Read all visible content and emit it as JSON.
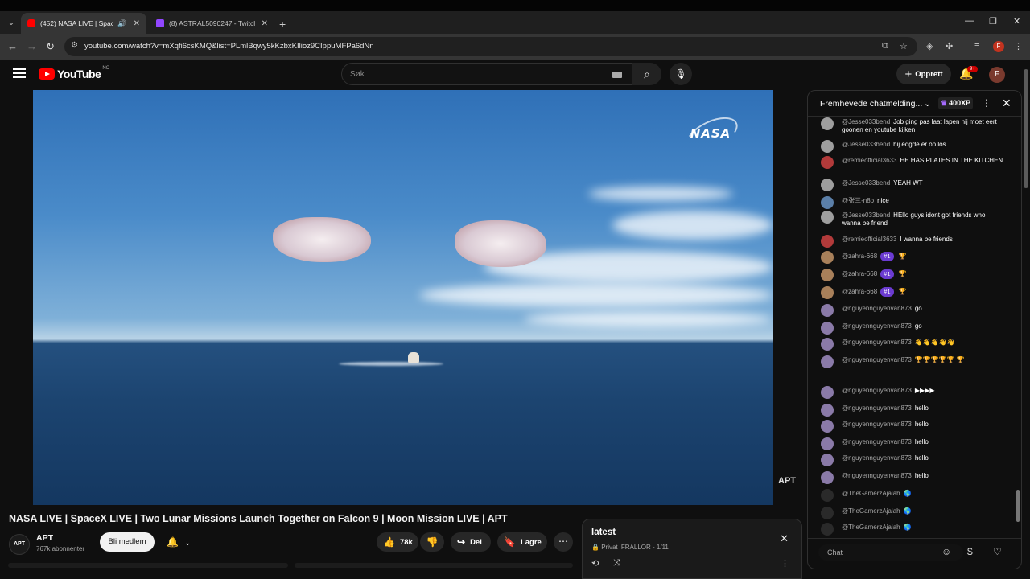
{
  "browser": {
    "tabs": [
      {
        "title": "(452) NASA LIVE | SpaceX LI",
        "icon": "youtube-icon",
        "active": true
      },
      {
        "title": "(8) ASTRAL5090247 - Twitch",
        "icon": "twitch-icon",
        "active": false
      }
    ],
    "url": "youtube.com/watch?v=mXqfi6csKMQ&list=PLmlBqwy5kKzbxKIlioz9CIppuMFPa6dNn"
  },
  "header": {
    "logo_text": "YouTube",
    "country_code": "NO",
    "search_placeholder": "Søk",
    "create_label": "Opprett",
    "notif_badge": "9+",
    "avatar_letter": "F"
  },
  "video": {
    "title": "NASA LIVE | SpaceX LIVE | Two Lunar Missions Launch Together on Falcon 9 | Moon Mission LIVE | APT",
    "watermark_logo": "NASA",
    "channel_watermark": "APT"
  },
  "channel": {
    "name": "APT",
    "subscribers": "767k abonnenter",
    "avatar_text": "APT",
    "join_label": "Bli medlem"
  },
  "actions": {
    "likes": "78k",
    "share_label": "Del",
    "save_label": "Lagre"
  },
  "playlist": {
    "title": "latest",
    "privacy": "Privat",
    "owner_progress": "FRALLOR - 1/11"
  },
  "chat": {
    "header_title": "Fremhevede chatmelding...",
    "xp": "400XP",
    "input_placeholder": "Chat",
    "messages": [
      {
        "author": "@Jesse033bend",
        "text": "Job ging pas laat lapen hij moet eert goonen en youtube kijken",
        "avatar_color": "#9e9e9e"
      },
      {
        "author": "@Jesse033bend",
        "text": "hij edgde er op los",
        "avatar_color": "#9e9e9e"
      },
      {
        "author": "@remieofficial3633",
        "text": "HE HAS PLATES IN THE KITCHEN",
        "avatar_color": "#b23a3a"
      },
      {
        "author": "@Jesse033bend",
        "text": "YEAH WT",
        "avatar_color": "#9e9e9e"
      },
      {
        "author": "@张三-n8o",
        "text": "nice",
        "avatar_color": "#5b7fa8"
      },
      {
        "author": "@Jesse033bend",
        "text": "HEllo guys idont got friends who wanna be friend",
        "avatar_color": "#9e9e9e"
      },
      {
        "author": "@remieofficial3633",
        "text": "I wanna be friends",
        "avatar_color": "#b23a3a"
      },
      {
        "author": "@zahra-668",
        "badge": "#1",
        "text": "🏆",
        "avatar_color": "#a8805a"
      },
      {
        "author": "@zahra-668",
        "badge": "#1",
        "text": "🏆",
        "avatar_color": "#a8805a"
      },
      {
        "author": "@zahra-668",
        "badge": "#1",
        "text": "🏆",
        "avatar_color": "#a8805a"
      },
      {
        "author": "@nguyennguyenvan873",
        "text": "go",
        "avatar_color": "#8a7aa8"
      },
      {
        "author": "@nguyennguyenvan873",
        "text": "go",
        "avatar_color": "#8a7aa8"
      },
      {
        "author": "@nguyennguyenvan873",
        "text": "👋👋👋👋👋",
        "avatar_color": "#8a7aa8"
      },
      {
        "author": "@nguyennguyenvan873",
        "text": "🏆🏆🏆🏆🏆 🏆",
        "avatar_color": "#8a7aa8"
      },
      {
        "author": "@nguyennguyenvan873",
        "text": "▶▶▶▶",
        "avatar_color": "#8a7aa8"
      },
      {
        "author": "@nguyennguyenvan873",
        "text": "hello",
        "avatar_color": "#8a7aa8"
      },
      {
        "author": "@nguyennguyenvan873",
        "text": "hello",
        "avatar_color": "#8a7aa8"
      },
      {
        "author": "@nguyennguyenvan873",
        "text": "hello",
        "avatar_color": "#8a7aa8"
      },
      {
        "author": "@nguyennguyenvan873",
        "text": "hello",
        "avatar_color": "#8a7aa8"
      },
      {
        "author": "@nguyennguyenvan873",
        "text": "hello",
        "avatar_color": "#8a7aa8"
      },
      {
        "author": "@TheGamerzAjalah",
        "text": "🌎",
        "avatar_color": "#2a2a2a"
      },
      {
        "author": "@TheGamerzAjalah",
        "text": "🌎",
        "avatar_color": "#2a2a2a"
      },
      {
        "author": "@TheGamerzAjalah",
        "text": "🌎",
        "avatar_color": "#2a2a2a"
      }
    ]
  }
}
